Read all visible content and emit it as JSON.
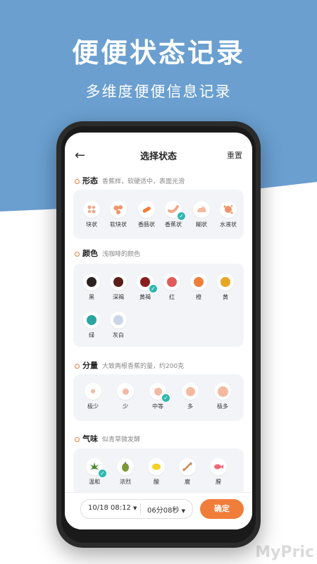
{
  "hero": {
    "title": "便便状态记录",
    "subtitle": "多维度便便信息记录"
  },
  "header": {
    "back_icon": "back-arrow-icon",
    "title": "选择状态",
    "reset_label": "重置"
  },
  "sections": {
    "shape": {
      "title": "形态",
      "desc": "香蕉样，软硬适中，表面光滑",
      "options": [
        {
          "label": "块状"
        },
        {
          "label": "软块状"
        },
        {
          "label": "香肠状"
        },
        {
          "label": "香蕉状",
          "selected": true
        },
        {
          "label": "糊状"
        },
        {
          "label": "水液状"
        }
      ]
    },
    "color": {
      "title": "颜色",
      "desc": "浅咖啡的颜色",
      "options": [
        {
          "label": "黑",
          "color": "#2b2222"
        },
        {
          "label": "深褐",
          "color": "#5a1f1a"
        },
        {
          "label": "黄褐",
          "color": "#8a1f1f",
          "selected": true
        },
        {
          "label": "红",
          "color": "#e25b5b"
        },
        {
          "label": "橙",
          "color": "#f07d3a"
        },
        {
          "label": "黄",
          "color": "#e8a626"
        },
        {
          "label": "绿",
          "color": "#2aa5a0"
        },
        {
          "label": "灰白",
          "color": "#c9d6e6"
        }
      ]
    },
    "amount": {
      "title": "分量",
      "desc": "大致两根香蕉的量，约200克",
      "options": [
        {
          "label": "极少"
        },
        {
          "label": "少"
        },
        {
          "label": "中等",
          "selected": true
        },
        {
          "label": "多"
        },
        {
          "label": "极多"
        }
      ]
    },
    "smell": {
      "title": "气味",
      "desc": "似青草微发酵",
      "options": [
        {
          "label": "温和",
          "icon": "leaf-icon",
          "selected": true
        },
        {
          "label": "浓烈",
          "icon": "durian-icon"
        },
        {
          "label": "酸",
          "icon": "lemon-icon"
        },
        {
          "label": "腐",
          "icon": "bone-icon"
        },
        {
          "label": "腥",
          "icon": "fish-icon"
        }
      ]
    }
  },
  "footer": {
    "datetime": "10/18 08:12",
    "duration": "06分08秒",
    "confirm_label": "确定"
  },
  "watermark": "MyPric"
}
